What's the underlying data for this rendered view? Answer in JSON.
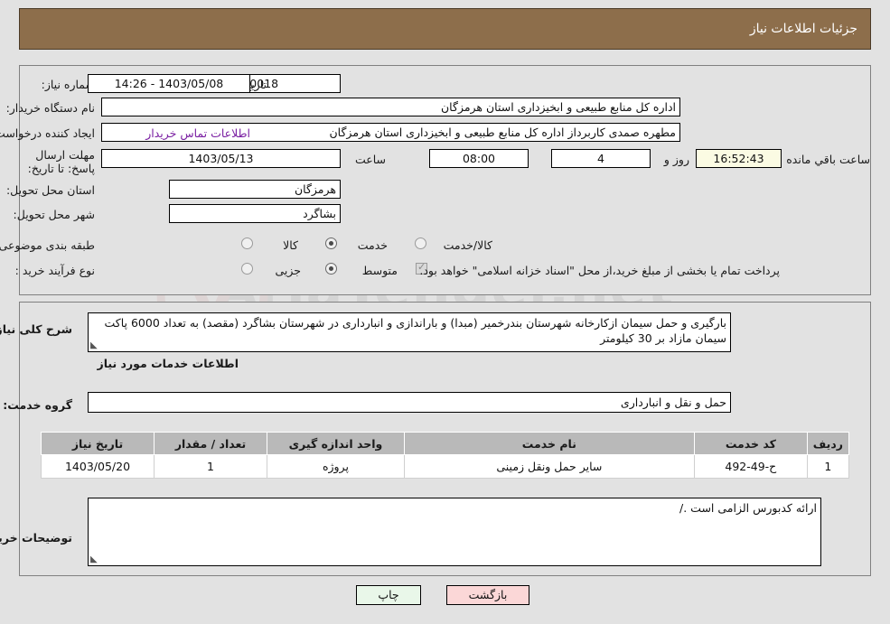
{
  "header": {
    "title": "جزئیات اطلاعات نیاز"
  },
  "top_panel": {
    "need_number_label": "شماره نیاز:",
    "need_number_value": "1103003899000018",
    "public_announce_label": "تاریخ و ساعت اعلان عمومی:",
    "public_announce_value": "1403/05/08 - 14:26",
    "buyer_org_label": "نام دستگاه خریدار:",
    "buyer_org_value": "اداره کل منابع طبیعی و ابخیزداری استان هرمزگان",
    "requester_label": "ایجاد کننده درخواست:",
    "requester_value": "مطهره صمدی کاربرداز اداره کل منابع طبیعی و ابخیزداری استان هرمزگان",
    "contact_link": "اطلاعات تماس خریدار",
    "deadline_label": "مهلت ارسال پاسخ: تا تاریخ:",
    "deadline_date": "1403/05/13",
    "hour_label": "ساعت",
    "deadline_time": "08:00",
    "days_value": "4",
    "days_unit": "روز و",
    "countdown": "16:52:43",
    "countdown_suffix": "ساعت باقي مانده",
    "province_label": "استان محل تحویل:",
    "province_value": "هرمزگان",
    "city_label": "شهر محل تحویل:",
    "city_value": "بشاگرد",
    "category_label": "طبقه بندی موضوعی:",
    "category_options": [
      {
        "label": "کالا",
        "selected": false
      },
      {
        "label": "خدمت",
        "selected": true
      },
      {
        "label": "کالا/خدمت",
        "selected": false
      }
    ],
    "process_label": "نوع فرآیند خرید :",
    "process_options": [
      {
        "label": "جزیی",
        "selected": false
      },
      {
        "label": "متوسط",
        "selected": true
      }
    ],
    "treasury_checkbox_checked": true,
    "treasury_text": "پرداخت تمام یا بخشی از مبلغ خرید،از محل \"اسناد خزانه اسلامی\" خواهد بود."
  },
  "bottom_panel": {
    "description_label": "شرح کلی نیاز:",
    "description_value": "بارگیری و حمل سیمان ازکارخانه شهرستان بندرخمیر (مبدا) و باراندازی و انبارداری در شهرستان بشاگرد (مقصد) به تعداد 6000 پاکت سیمان مازاد بر 30 کیلومتر",
    "services_heading": "اطلاعات خدمات مورد نیاز",
    "service_group_label": "گروه خدمت:",
    "service_group_value": "حمل و نقل و انبارداری",
    "table": {
      "columns": [
        "ردیف",
        "کد خدمت",
        "نام خدمت",
        "واحد اندازه گیری",
        "تعداد / مقدار",
        "تاریخ نیاز"
      ],
      "rows": [
        [
          "1",
          "ح-49-492",
          "سایر حمل ونقل زمینی",
          "پروژه",
          "1",
          "1403/05/20"
        ]
      ]
    },
    "buyer_notes_label": "توضیحات خریدار:",
    "buyer_notes_value": "ارائه کدبورس الزامی است ./"
  },
  "footer": {
    "print_label": "چاپ",
    "back_label": "بازگشت"
  },
  "watermark": {
    "text": "AriaTender.net"
  },
  "colors": {
    "header_bg": "#8d6e4b",
    "page_bg": "#e2e2e2",
    "link": "#7a1fa2",
    "table_header_bg": "#b9b9b9",
    "countdown_bg": "#fbfbe3",
    "print_btn_bg": "#e9f7e9",
    "back_btn_bg": "#fbd7d7"
  }
}
